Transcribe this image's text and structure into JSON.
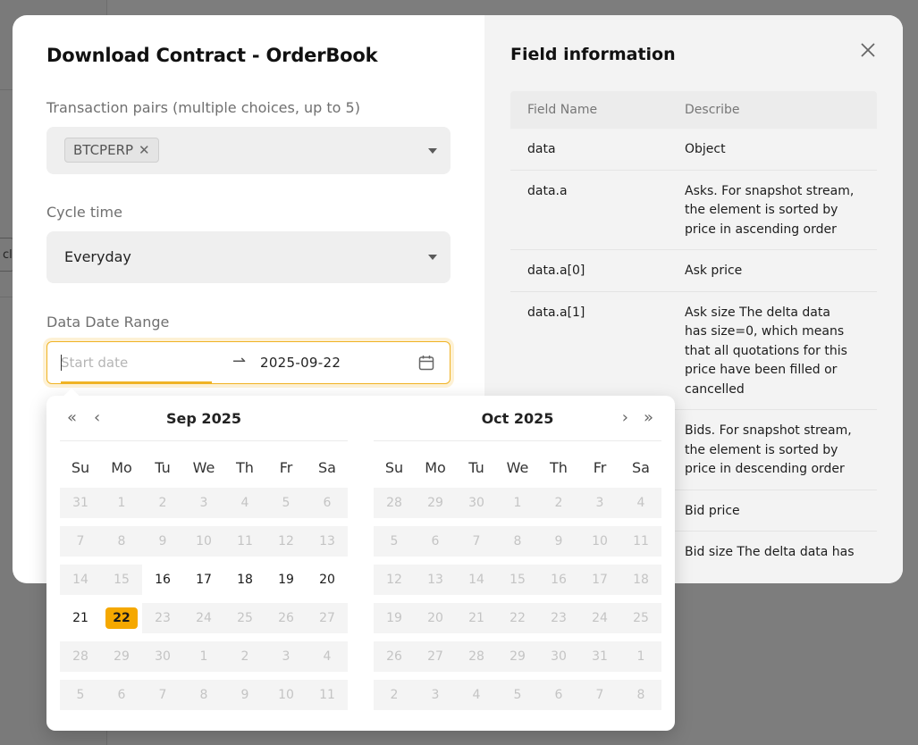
{
  "background": {
    "partial_label": "cl"
  },
  "modal": {
    "title": "Download Contract - OrderBook",
    "pairs_label": "Transaction pairs (multiple choices, up to 5)",
    "selected_pair": "BTCPERP",
    "cycle_label": "Cycle time",
    "cycle_value": "Everyday",
    "range_label": "Data Date Range",
    "start_placeholder": "Start date",
    "end_date": "2025-09-22",
    "range_separator": "⇀"
  },
  "field_info": {
    "title": "Field information",
    "headers": {
      "name": "Field Name",
      "describe": "Describe"
    },
    "rows": [
      {
        "name": "data",
        "describe": "Object"
      },
      {
        "name": "data.a",
        "describe": "Asks. For snapshot stream, the element is sorted by price in ascending order"
      },
      {
        "name": "data.a[0]",
        "describe": "Ask price"
      },
      {
        "name": "data.a[1]",
        "describe": "Ask size The delta data has size=0, which means that all quotations for this price have been filled or cancelled"
      },
      {
        "name": "",
        "describe": "Bids. For snapshot stream, the element is sorted by price in descending order"
      },
      {
        "name": "",
        "describe": "Bid price"
      },
      {
        "name": "",
        "describe": "Bid size The delta data has"
      }
    ]
  },
  "datepicker": {
    "weekdays": [
      "Su",
      "Mo",
      "Tu",
      "We",
      "Th",
      "Fr",
      "Sa"
    ],
    "accent": "#f5a800",
    "months": [
      {
        "title": "Sep 2025",
        "weeks": [
          [
            "31",
            "1",
            "2",
            "3",
            "4",
            "5",
            "6"
          ],
          [
            "7",
            "8",
            "9",
            "10",
            "11",
            "12",
            "13"
          ],
          [
            "14",
            "15",
            "16",
            "17",
            "18",
            "19",
            "20"
          ],
          [
            "21",
            "22",
            "23",
            "24",
            "25",
            "26",
            "27"
          ],
          [
            "28",
            "29",
            "30",
            "1",
            "2",
            "3",
            "4"
          ],
          [
            "5",
            "6",
            "7",
            "8",
            "9",
            "10",
            "11"
          ]
        ]
      },
      {
        "title": "Oct 2025",
        "weeks": [
          [
            "28",
            "29",
            "30",
            "1",
            "2",
            "3",
            "4"
          ],
          [
            "5",
            "6",
            "7",
            "8",
            "9",
            "10",
            "11"
          ],
          [
            "12",
            "13",
            "14",
            "15",
            "16",
            "17",
            "18"
          ],
          [
            "19",
            "20",
            "21",
            "22",
            "23",
            "24",
            "25"
          ],
          [
            "26",
            "27",
            "28",
            "29",
            "30",
            "31",
            "1"
          ],
          [
            "2",
            "3",
            "4",
            "5",
            "6",
            "7",
            "8"
          ]
        ]
      }
    ]
  }
}
